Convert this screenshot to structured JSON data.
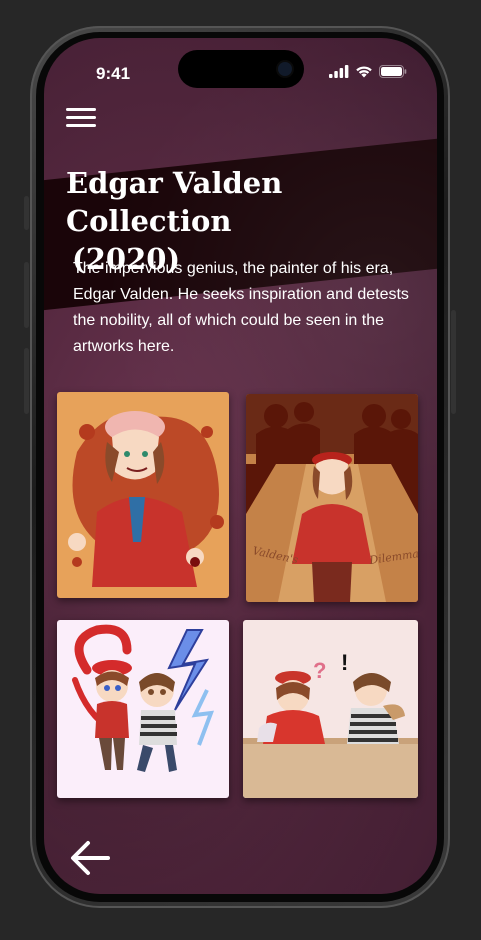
{
  "status_bar": {
    "time": "9:41"
  },
  "header": {
    "title_line1": "Edgar Valden Collection",
    "title_line2": "(2020)",
    "description": "The impervious genius, the painter of his era, Edgar Valden. He seeks inspiration and detests the nobility, all of which could be seen in the artworks here."
  },
  "artworks": [
    {
      "name": "artwork-1",
      "bg": "#e7a25a",
      "accent": "#b43a1e"
    },
    {
      "name": "artwork-2",
      "bg": "#b8743e",
      "accent": "#5a1608",
      "caption_left": "Valden's",
      "caption_right": "Dilemma"
    },
    {
      "name": "artwork-3",
      "bg": "#fbeefa",
      "accent": "#d42b2b"
    },
    {
      "name": "artwork-4",
      "bg": "#f6e6e4",
      "accent": "#c9352b"
    }
  ],
  "icons": {
    "menu": "hamburger-menu-icon",
    "back": "arrow-left-icon"
  }
}
